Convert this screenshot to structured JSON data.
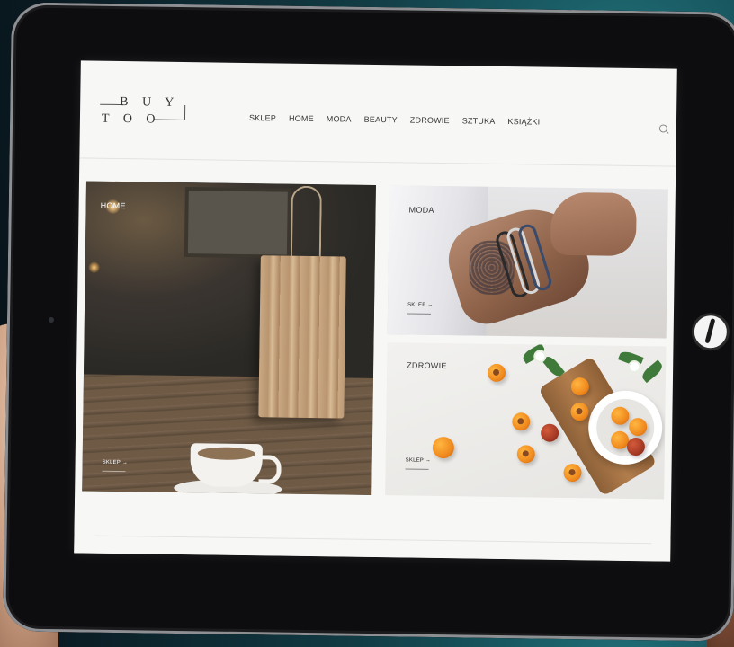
{
  "logo": {
    "line1": "B U Y",
    "line2": "T O O"
  },
  "nav": {
    "items": [
      "SKLEP",
      "HOME",
      "MODA",
      "BEAUTY",
      "ZDROWIE",
      "SZTUKA",
      "KSIĄŻKI"
    ]
  },
  "tiles": {
    "home": {
      "label": "HOME",
      "cta": "SKLEP →"
    },
    "moda": {
      "label": "MODA",
      "cta": "SKLEP →"
    },
    "zdrowie": {
      "label": "ZDROWIE",
      "cta": "SKLEP →"
    }
  },
  "icons": {
    "search": "search-icon",
    "home_button": "home-button-icon"
  },
  "colors": {
    "screen_bg": "#f7f7f5",
    "text": "#333333",
    "accent_teal": "#1e8a86",
    "bezel": "#0d0d0f"
  }
}
